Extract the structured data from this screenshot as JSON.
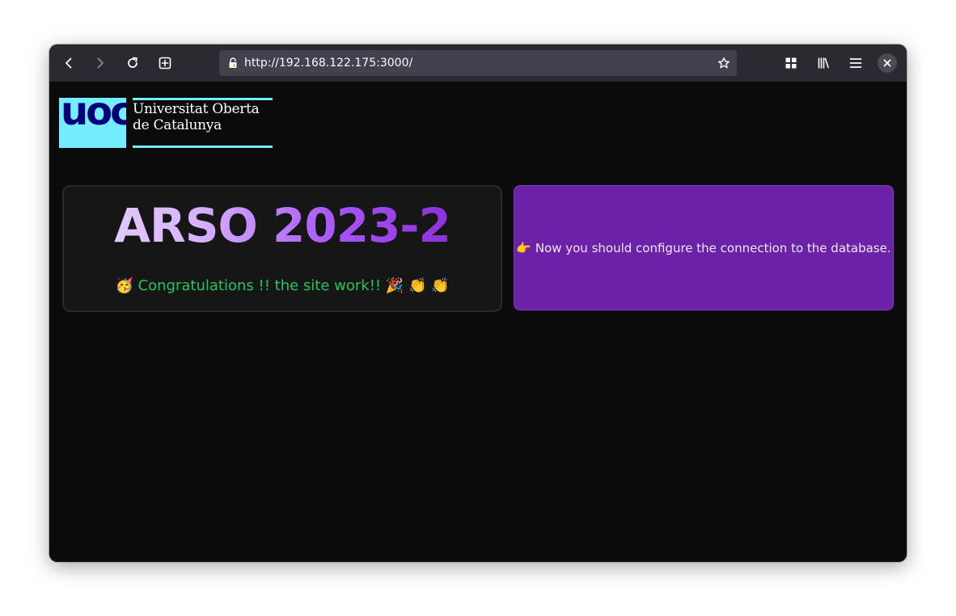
{
  "browser": {
    "url": "http://192.168.122.175:3000/",
    "icons": [
      "back-icon",
      "forward-icon",
      "reload-icon",
      "new-tab-icon",
      "lock-icon",
      "star-icon",
      "extensions-icon",
      "library-icon",
      "menu-icon",
      "close-icon"
    ]
  },
  "logo": {
    "mark": "uoc",
    "line1": "Universitat Oberta",
    "line2": "de Catalunya"
  },
  "main": {
    "title": "ARSO 2023-2",
    "congrats": "🥳 Congratulations !! the site work!! 🎉 👏 👏",
    "db_message": "👉 Now you should configure the connection to the database."
  },
  "colors": {
    "page_bg": "#0b0b0b",
    "accent_purple": "#6b21a8",
    "success_green": "#22c55e",
    "uoc_cyan": "#73edff",
    "uoc_navy": "#000078"
  }
}
